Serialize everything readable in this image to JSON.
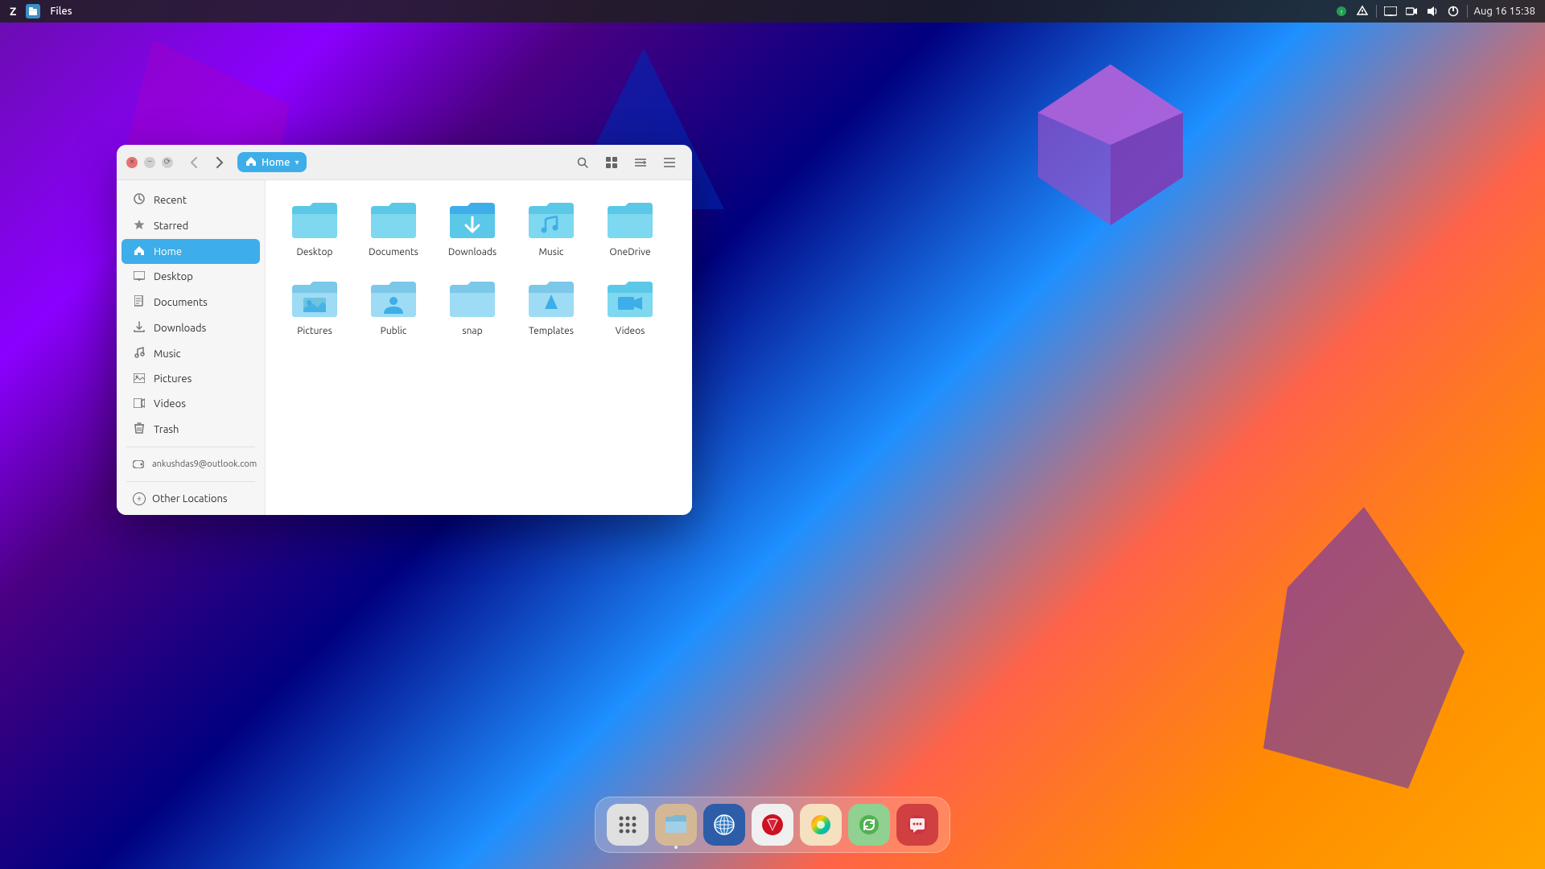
{
  "desktop": {
    "bg_colors": [
      "#6a0dad",
      "#000080",
      "#ff6347",
      "#ffa500"
    ]
  },
  "topbar": {
    "app_icon": "🗂",
    "app_title": "Files",
    "datetime": "Aug 16  15:38",
    "z_label": "Z"
  },
  "file_manager": {
    "titlebar": {
      "close_label": "×",
      "minimize_label": "−",
      "maximize_label": "⟳",
      "back_label": "←",
      "forward_label": "→",
      "location_label": "Home",
      "location_dropdown": "▾",
      "search_label": "🔍",
      "view_toggle_label": "⊞",
      "view_option_label": "⌄",
      "menu_label": "☰"
    },
    "sidebar": {
      "items": [
        {
          "id": "recent",
          "label": "Recent",
          "icon": "🕐",
          "active": false
        },
        {
          "id": "starred",
          "label": "Starred",
          "icon": "★",
          "active": false
        },
        {
          "id": "home",
          "label": "Home",
          "icon": "🏠",
          "active": true
        },
        {
          "id": "desktop",
          "label": "Desktop",
          "icon": "🖥",
          "active": false
        },
        {
          "id": "documents",
          "label": "Documents",
          "icon": "📄",
          "active": false
        },
        {
          "id": "downloads",
          "label": "Downloads",
          "icon": "⬇",
          "active": false
        },
        {
          "id": "music",
          "label": "Music",
          "icon": "♪",
          "active": false
        },
        {
          "id": "pictures",
          "label": "Pictures",
          "icon": "🖼",
          "active": false
        },
        {
          "id": "videos",
          "label": "Videos",
          "icon": "🎬",
          "active": false
        },
        {
          "id": "trash",
          "label": "Trash",
          "icon": "🗑",
          "active": false
        }
      ],
      "drive_items": [
        {
          "id": "drive",
          "label": "ankushdas9@outlook.com",
          "icon": "💿",
          "eject": true
        }
      ],
      "other_label": "Other Locations"
    },
    "files": [
      {
        "id": "desktop",
        "label": "Desktop",
        "type": "folder",
        "variant": "normal"
      },
      {
        "id": "documents",
        "label": "Documents",
        "type": "folder",
        "variant": "normal"
      },
      {
        "id": "downloads",
        "label": "Downloads",
        "type": "folder",
        "variant": "download"
      },
      {
        "id": "music",
        "label": "Music",
        "type": "folder",
        "variant": "music"
      },
      {
        "id": "onedrive",
        "label": "OneDrive",
        "type": "folder",
        "variant": "normal"
      },
      {
        "id": "pictures",
        "label": "Pictures",
        "type": "folder",
        "variant": "pictures"
      },
      {
        "id": "public",
        "label": "Public",
        "type": "folder",
        "variant": "people"
      },
      {
        "id": "snap",
        "label": "snap",
        "type": "folder",
        "variant": "normal"
      },
      {
        "id": "templates",
        "label": "Templates",
        "type": "folder",
        "variant": "templates"
      },
      {
        "id": "videos",
        "label": "Videos",
        "type": "folder",
        "variant": "video"
      }
    ]
  },
  "dock": {
    "items": [
      {
        "id": "apps-grid",
        "label": "⋮⋮⋮",
        "color": "#555",
        "bg": "#ddd",
        "dot": false
      },
      {
        "id": "files",
        "label": "📂",
        "color": "",
        "bg": "#e8d5a0",
        "dot": true
      },
      {
        "id": "browser",
        "label": "🌐",
        "color": "",
        "bg": "#3d7fc4",
        "dot": false
      },
      {
        "id": "vivaldi",
        "label": "V",
        "color": "#c00",
        "bg": "#e8e8e8",
        "dot": false
      },
      {
        "id": "color-app",
        "label": "🎨",
        "color": "",
        "bg": "#f0d0b0",
        "dot": false
      },
      {
        "id": "update",
        "label": "🔄",
        "color": "",
        "bg": "#a0e0a0",
        "dot": false
      },
      {
        "id": "chat",
        "label": "💬",
        "color": "",
        "bg": "#e05050",
        "dot": false
      }
    ]
  }
}
